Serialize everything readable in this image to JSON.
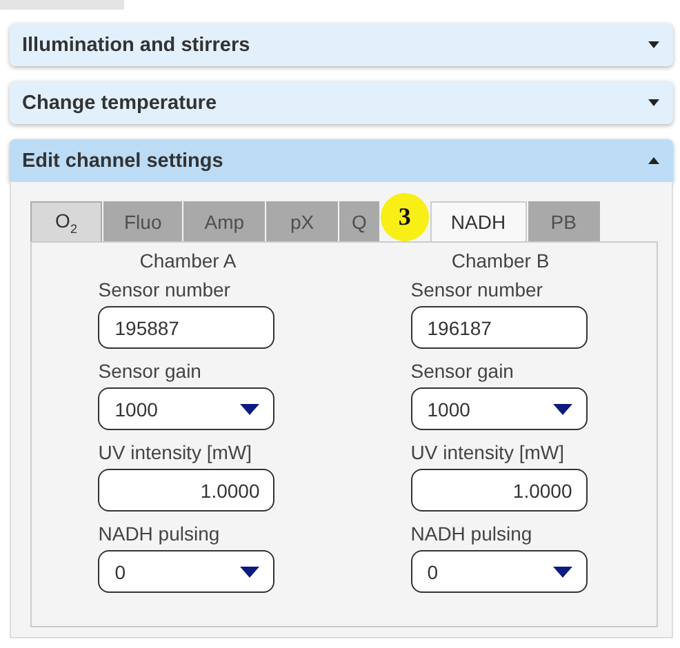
{
  "sections": [
    {
      "title": "Illumination and stirrers",
      "expanded": false
    },
    {
      "title": "Change temperature",
      "expanded": false
    },
    {
      "title": "Edit channel settings",
      "expanded": true
    }
  ],
  "tabs": [
    {
      "label": "O$_{2}$",
      "selected": false,
      "disabled": false
    },
    {
      "label": "Fluo",
      "selected": false,
      "disabled": true
    },
    {
      "label": "Amp",
      "selected": false,
      "disabled": true
    },
    {
      "label": "pX",
      "selected": false,
      "disabled": true
    },
    {
      "label": "Q",
      "selected": false,
      "disabled": true
    },
    {
      "label": "NADH",
      "selected": true,
      "disabled": false
    },
    {
      "label": "PB",
      "selected": false,
      "disabled": true
    }
  ],
  "badge": {
    "text": "3"
  },
  "chambers": [
    {
      "title": "Chamber A",
      "fields": [
        {
          "kind": "text",
          "label": "Sensor number",
          "value": "195887"
        },
        {
          "kind": "select",
          "label": "Sensor gain",
          "value": "1000"
        },
        {
          "kind": "number",
          "label": "UV intensity [mW]",
          "value": "1.0000"
        },
        {
          "kind": "select",
          "label": "NADH pulsing",
          "value": "0"
        }
      ]
    },
    {
      "title": "Chamber B",
      "fields": [
        {
          "kind": "text",
          "label": "Sensor number",
          "value": "196187"
        },
        {
          "kind": "select",
          "label": "Sensor gain",
          "value": "1000"
        },
        {
          "kind": "number",
          "label": "UV intensity [mW]",
          "value": "1.0000"
        },
        {
          "kind": "select",
          "label": "NADH pulsing",
          "value": "0"
        }
      ]
    }
  ]
}
